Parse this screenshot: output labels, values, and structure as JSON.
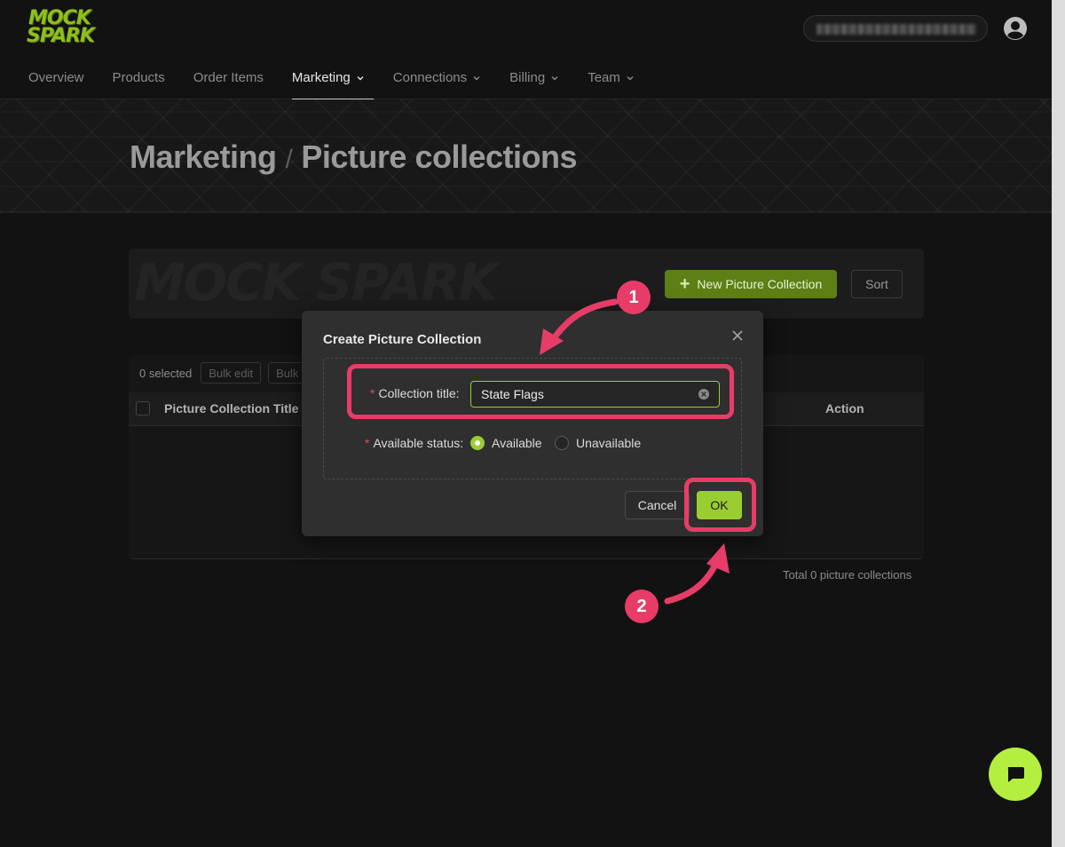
{
  "brand": {
    "logo_line1": "MOCK",
    "logo_line2": "SPARK"
  },
  "nav": {
    "items": [
      {
        "label": "Overview"
      },
      {
        "label": "Products"
      },
      {
        "label": "Order Items"
      },
      {
        "label": "Marketing",
        "active": true
      },
      {
        "label": "Connections"
      },
      {
        "label": "Billing"
      },
      {
        "label": "Team"
      }
    ]
  },
  "header": {
    "section": "Marketing",
    "separator": "/",
    "page": "Picture collections"
  },
  "toolbar": {
    "watermark": "MOCK SPARK",
    "new_label": "New Picture Collection",
    "sort_label": "Sort"
  },
  "table": {
    "selected": "0 selected",
    "bulk_edit": "Bulk edit",
    "bulk_more": "Bulk",
    "col_title": "Picture Collection Title",
    "col_action": "Action",
    "total": "Total 0 picture collections"
  },
  "modal": {
    "title": "Create Picture Collection",
    "field_title_label": "Collection title",
    "field_title_value": "State Flags",
    "field_status_label": "Available status",
    "status_options": [
      "Available",
      "Unavailable"
    ],
    "status_selected": "Available",
    "cancel_label": "Cancel",
    "ok_label": "OK"
  },
  "annotations": {
    "step1": "1",
    "step2": "2"
  },
  "colors": {
    "accent": "#9acd32",
    "annotation": "#e83c68",
    "background": "#121212"
  }
}
